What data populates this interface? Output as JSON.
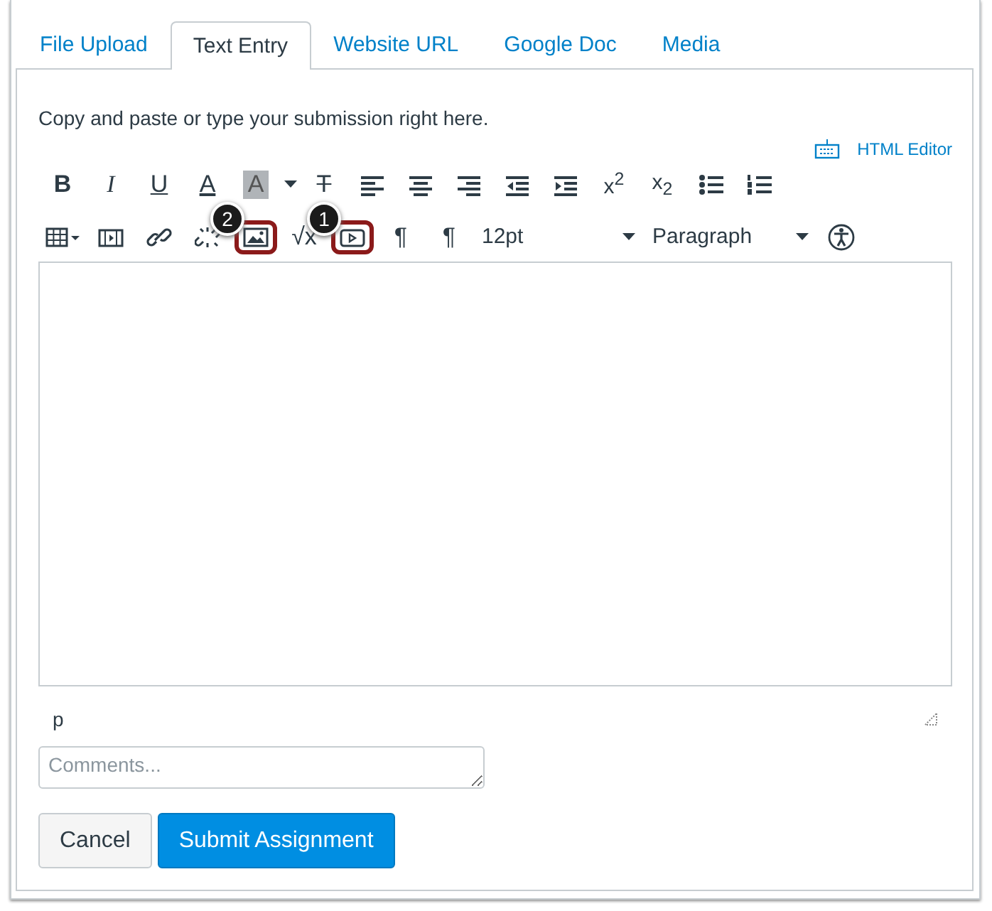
{
  "tabs": [
    {
      "label": "File Upload",
      "selected": false
    },
    {
      "label": "Text Entry",
      "selected": true
    },
    {
      "label": "Website URL",
      "selected": false
    },
    {
      "label": "Google Doc",
      "selected": false
    },
    {
      "label": "Media",
      "selected": false
    }
  ],
  "instructions": "Copy and paste or type your submission right here.",
  "html_editor_link": "HTML Editor",
  "toolbar_rows": [
    [
      {
        "kind": "bold",
        "label": "B"
      },
      {
        "kind": "italic",
        "label": "I"
      },
      {
        "kind": "underline",
        "label": "U"
      },
      {
        "kind": "textcolor",
        "label": "A"
      },
      {
        "kind": "bgcolor",
        "label": "A"
      },
      {
        "kind": "caret"
      },
      {
        "kind": "strike",
        "label": "T"
      },
      {
        "kind": "align-left"
      },
      {
        "kind": "align-center"
      },
      {
        "kind": "align-right"
      },
      {
        "kind": "outdent"
      },
      {
        "kind": "indent"
      },
      {
        "kind": "script",
        "label": "x$^{2}$"
      },
      {
        "kind": "script",
        "label": "x$_{2}$"
      },
      {
        "kind": "bullets"
      },
      {
        "kind": "numbers"
      }
    ],
    [
      {
        "kind": "table"
      },
      {
        "kind": "embed"
      },
      {
        "kind": "link"
      },
      {
        "kind": "unlink"
      },
      {
        "kind": "image",
        "highlighted": true,
        "callout": "2"
      },
      {
        "kind": "math",
        "label": "√x"
      },
      {
        "kind": "media",
        "highlighted": true,
        "callout": "1"
      },
      {
        "kind": "ltr",
        "label": "¶"
      },
      {
        "kind": "rtl",
        "label": "¶"
      },
      {
        "kind": "select",
        "label": "12pt"
      },
      {
        "kind": "select",
        "label": "Paragraph"
      },
      {
        "kind": "accessibility"
      }
    ]
  ],
  "status_path": "p",
  "comments": {
    "placeholder": "Comments..."
  },
  "buttons": [
    {
      "label": "Cancel",
      "kind": "secondary"
    },
    {
      "label": "Submit Assignment",
      "kind": "primary"
    }
  ]
}
